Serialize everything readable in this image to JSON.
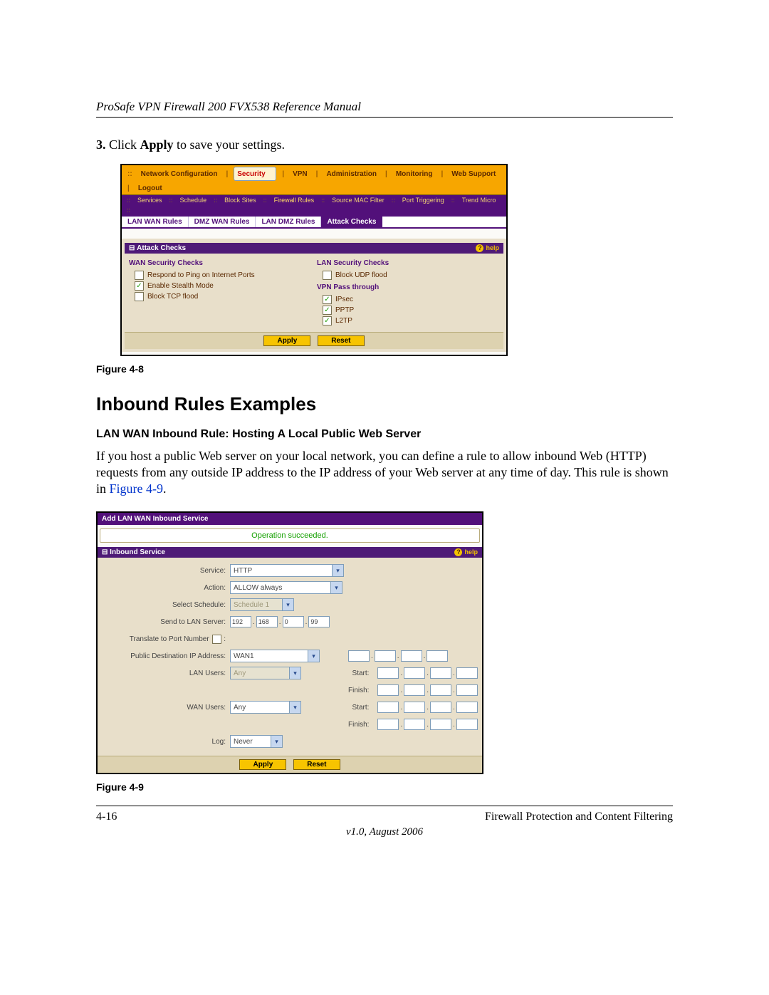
{
  "running_head": "ProSafe VPN Firewall 200 FVX538 Reference Manual",
  "step3": {
    "num": "3.",
    "pre": " Click ",
    "bold": "Apply",
    "post": " to save your settings."
  },
  "fig8": {
    "caption": "Figure 4-8",
    "nav": {
      "items": [
        "Network Configuration",
        "Security",
        "VPN",
        "Administration",
        "Monitoring",
        "Web Support",
        "Logout"
      ],
      "active_index": 1
    },
    "subnav": {
      "items": [
        "Services",
        "Schedule",
        "Block Sites",
        "Firewall Rules",
        "Source MAC Filter",
        "Port Triggering",
        "Trend Micro"
      ],
      "active_index": 3
    },
    "tabs": {
      "items": [
        "LAN WAN Rules",
        "DMZ WAN Rules",
        "LAN DMZ Rules",
        "Attack Checks"
      ],
      "active_index": 3
    },
    "panel_title": "Attack Checks",
    "help_label": "help",
    "wan_header": "WAN Security Checks",
    "lan_header": "LAN Security Checks",
    "wan_checks": [
      {
        "label": "Respond to Ping on Internet Ports",
        "checked": false
      },
      {
        "label": "Enable Stealth Mode",
        "checked": true
      },
      {
        "label": "Block TCP flood",
        "checked": false
      }
    ],
    "lan_checks": [
      {
        "label": "Block UDP flood",
        "checked": false
      }
    ],
    "vpn_header": "VPN Pass through",
    "vpn_checks": [
      {
        "label": "IPsec",
        "checked": true
      },
      {
        "label": "PPTP",
        "checked": true
      },
      {
        "label": "L2TP",
        "checked": true
      }
    ],
    "buttons": {
      "apply": "Apply",
      "reset": "Reset"
    }
  },
  "section_heading": "Inbound Rules Examples",
  "subsection_heading": "LAN WAN Inbound Rule: Hosting A Local Public Web Server",
  "para": {
    "line1": "If you host a public Web server on your local network, you can define a rule to allow inbound Web (HTTP) requests from any outside IP address to the IP address of your Web server at any time of day. This rule is shown in ",
    "link": "Figure 4-9",
    "after": "."
  },
  "fig9": {
    "caption": "Figure 4-9",
    "titlebar": "Add LAN WAN Inbound Service",
    "status_msg": "Operation succeeded.",
    "panel_title": "Inbound Service",
    "help_label": "help",
    "labels": {
      "service": "Service:",
      "action": "Action:",
      "schedule": "Select Schedule:",
      "send_to": "Send to LAN Server:",
      "translate": "Translate to Port Number",
      "translate_colon": ":",
      "pubdest": "Public Destination IP Address:",
      "lanusers": "LAN Users:",
      "wanusers": "WAN Users:",
      "log": "Log:",
      "start": "Start:",
      "finish": "Finish:"
    },
    "values": {
      "service": "HTTP",
      "action": "ALLOW always",
      "schedule": "Schedule 1",
      "ip": {
        "a": "192",
        "b": "168",
        "c": "0",
        "d": "99"
      },
      "pubdest": "WAN1",
      "lanusers": "Any",
      "wanusers": "Any",
      "log": "Never"
    },
    "buttons": {
      "apply": "Apply",
      "reset": "Reset"
    }
  },
  "footer": {
    "left": "4-16",
    "right": "Firewall Protection and Content Filtering",
    "version": "v1.0, August 2006"
  }
}
